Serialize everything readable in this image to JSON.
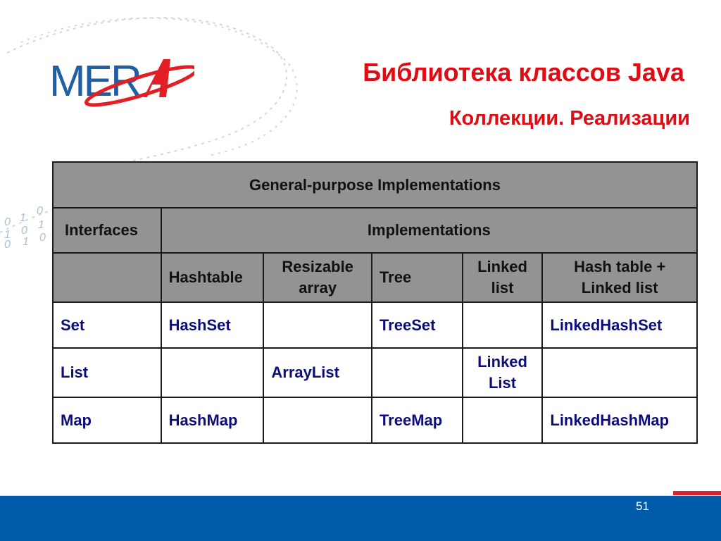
{
  "slide": {
    "logo_text": "MERA",
    "title": "Библиотека классов Java",
    "subtitle": "Коллекции. Реализации",
    "page_number": "51",
    "colors": {
      "title": "#e00c14",
      "header_bg": "#939393",
      "body_text": "#0d0d7a",
      "footer_band": "#005bab",
      "footer_accent": "#d7252d",
      "logo_blue": "#1f5fa8",
      "logo_red": "#e31e24"
    }
  },
  "table": {
    "caption": "General-purpose Implementations",
    "interfaces_label": "Interfaces",
    "implementations_label": "Implementations",
    "columns": [
      "Hashtable",
      "Resizable\narray",
      "Tree",
      "Linked\nlist",
      "Hash table +\nLinked list"
    ],
    "rows": [
      {
        "interface": "Set",
        "cells": [
          "HashSet",
          "",
          "TreeSet",
          "",
          "LinkedHashSet"
        ]
      },
      {
        "interface": "List",
        "cells": [
          "",
          "ArrayList",
          "",
          "Linked\nList",
          ""
        ]
      },
      {
        "interface": "Map",
        "cells": [
          "HashMap",
          "",
          "TreeMap",
          "",
          "LinkedHashMap"
        ]
      }
    ]
  }
}
